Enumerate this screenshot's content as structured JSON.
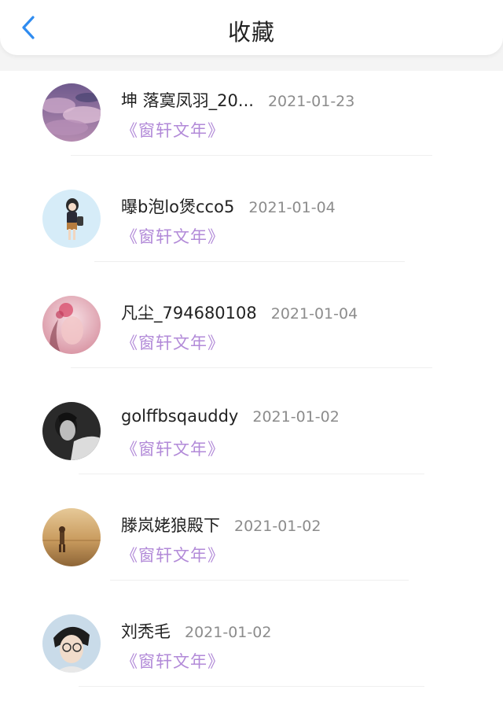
{
  "header": {
    "title": "收藏",
    "back_icon": "chevron-left-icon",
    "accent_color": "#2f8cf0"
  },
  "favorites": [
    {
      "username": "坤 落寞凤羽_20...",
      "date": "2021-01-23",
      "book": "《窗轩文年》",
      "avatar": "purple-clouds-avatar"
    },
    {
      "username": "曝b泡lo煲cco5",
      "date": "2021-01-04",
      "book": "《窗轩文年》",
      "avatar": "cartoon-girl-avatar"
    },
    {
      "username": "凡尘_794680108",
      "date": "2021-01-04",
      "book": "《窗轩文年》",
      "avatar": "pink-floral-girl-avatar"
    },
    {
      "username": "golffbsqauddy",
      "date": "2021-01-02",
      "book": "《窗轩文年》",
      "avatar": "monochrome-portrait-avatar"
    },
    {
      "username": "滕岚姥狼殿下",
      "date": "2021-01-02",
      "book": "《窗轩文年》",
      "avatar": "desert-traveler-avatar"
    },
    {
      "username": "刘秃毛",
      "date": "2021-01-02",
      "book": "《窗轩文年》",
      "avatar": "boy-glasses-avatar"
    }
  ],
  "colors": {
    "book_title": "#b28ad8",
    "date": "#8c8c8c"
  }
}
